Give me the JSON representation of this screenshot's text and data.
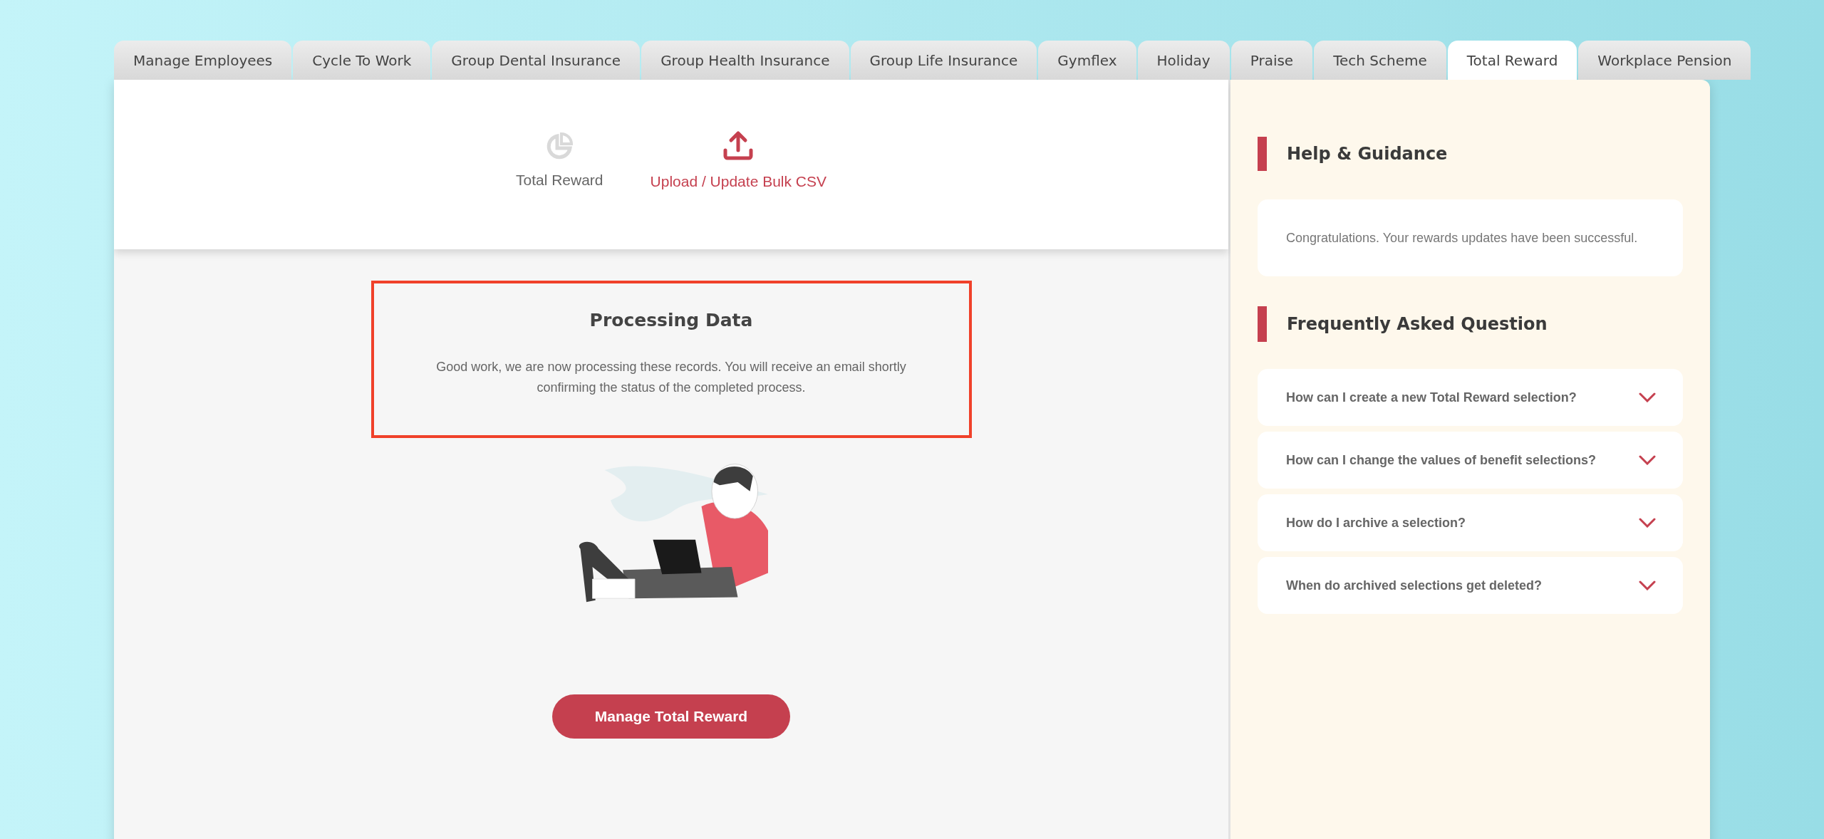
{
  "tabs": [
    {
      "label": "Manage Employees",
      "selected": false
    },
    {
      "label": "Cycle To Work",
      "selected": false
    },
    {
      "label": "Group Dental Insurance",
      "selected": false
    },
    {
      "label": "Group Health Insurance",
      "selected": false
    },
    {
      "label": "Group Life Insurance",
      "selected": false
    },
    {
      "label": "Gymflex",
      "selected": false
    },
    {
      "label": "Holiday",
      "selected": false
    },
    {
      "label": "Praise",
      "selected": false
    },
    {
      "label": "Tech Scheme",
      "selected": false
    },
    {
      "label": "Total Reward",
      "selected": true
    },
    {
      "label": "Workplace Pension",
      "selected": false
    }
  ],
  "sub_nav": [
    {
      "label": "Total Reward",
      "kind": "chart",
      "selected": false
    },
    {
      "label": "Upload / Update Bulk CSV",
      "kind": "upload",
      "selected": true
    }
  ],
  "processing": {
    "title": "Processing Data",
    "message": "Good work, we are now processing these records. You will receive an email shortly confirming the status of the completed process."
  },
  "primary_button": "Manage Total Reward",
  "help": {
    "title": "Help & Guidance",
    "message": "Congratulations. Your rewards updates have been successful."
  },
  "faq": {
    "title": "Frequently Asked Question",
    "items": [
      {
        "question": "How can I create a new Total Reward selection?",
        "expanded": false
      },
      {
        "question": "How can I change the values of benefit selections?",
        "expanded": false
      },
      {
        "question": "How do I archive a selection?",
        "expanded": false
      },
      {
        "question": "When do archived selections get deleted?",
        "expanded": false
      }
    ]
  }
}
